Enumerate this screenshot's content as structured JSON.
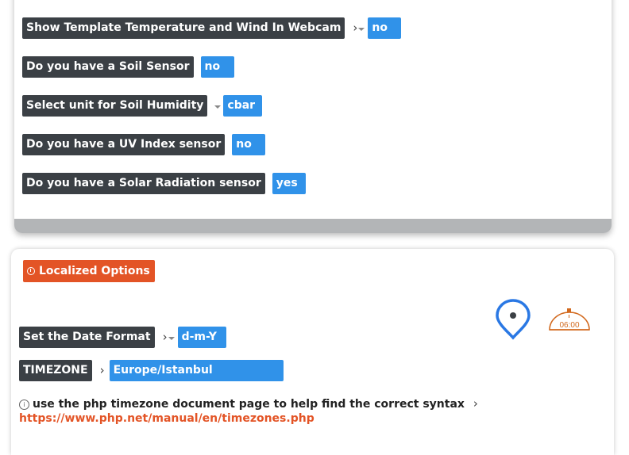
{
  "weather_options": [
    {
      "label": "Show Template Temperature and Wind In Webcam",
      "value": "no"
    },
    {
      "label": "Do you have a Soil Sensor",
      "value": "no"
    },
    {
      "label": "Select unit for Soil Humidity",
      "value": "cbar"
    },
    {
      "label": "Do you have a UV Index sensor",
      "value": "no"
    },
    {
      "label": "Do you have a Solar Radiation sensor",
      "value": "yes"
    }
  ],
  "localized": {
    "badge_label": "Localized Options",
    "date_format_label": "Set the Date Format",
    "date_format_value": "d-m-Y",
    "timezone_label": "TIMEZONE",
    "timezone_value": "Europe/Istanbul",
    "help_text": "use the php timezone document page to help find the correct syntax",
    "help_link": "https://www.php.net/manual/en/timezones.php",
    "clock_time": "06:00"
  },
  "colors": {
    "label_bg": "#3b4045",
    "value_bg": "#3092e9",
    "accent_orange": "#e35426",
    "map_pin_blue": "#2a78e4"
  }
}
